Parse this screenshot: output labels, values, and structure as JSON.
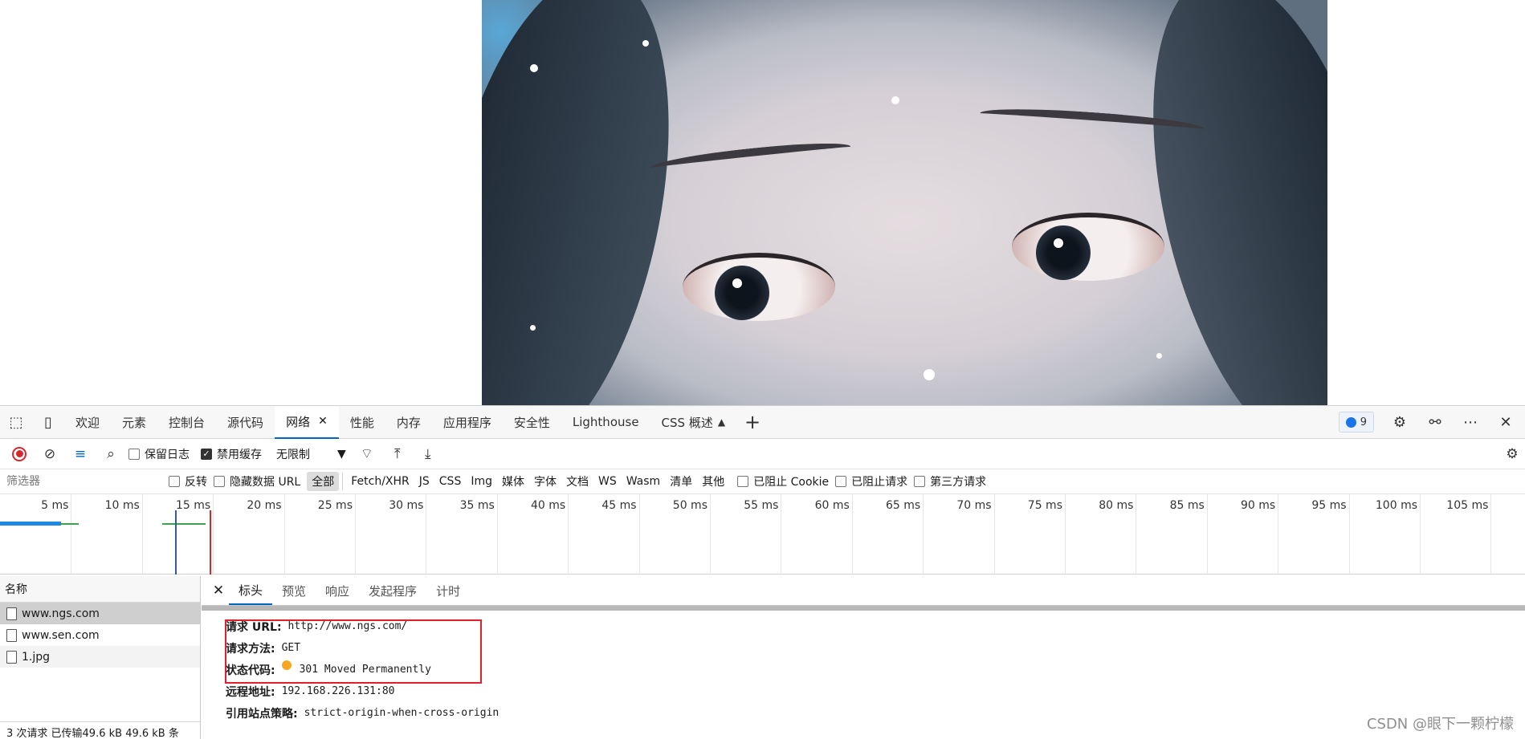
{
  "devtools": {
    "tabs": [
      "欢迎",
      "元素",
      "控制台",
      "源代码",
      "网络",
      "性能",
      "内存",
      "应用程序",
      "安全性",
      "Lighthouse",
      "CSS 概述"
    ],
    "active_tab": "网络",
    "issues_count": "9"
  },
  "toolbar": {
    "preserve_log": "保留日志",
    "disable_cache": "禁用缓存",
    "throttle": "无限制"
  },
  "filter": {
    "placeholder": "筛选器",
    "invert": "反转",
    "hide_data_url": "隐藏数据 URL",
    "types": [
      "全部",
      "Fetch/XHR",
      "JS",
      "CSS",
      "Img",
      "媒体",
      "字体",
      "文档",
      "WS",
      "Wasm",
      "清单",
      "其他"
    ],
    "blocked_cookie": "已阻止 Cookie",
    "blocked_request": "已阻止请求",
    "third_party": "第三方请求"
  },
  "timeline": {
    "ticks": [
      "5 ms",
      "10 ms",
      "15 ms",
      "20 ms",
      "25 ms",
      "30 ms",
      "35 ms",
      "40 ms",
      "45 ms",
      "50 ms",
      "55 ms",
      "60 ms",
      "65 ms",
      "70 ms",
      "75 ms",
      "80 ms",
      "85 ms",
      "90 ms",
      "95 ms",
      "100 ms",
      "105 ms"
    ]
  },
  "requests": {
    "header": "名称",
    "items": [
      "www.ngs.com",
      "www.sen.com",
      "1.jpg"
    ],
    "status": "3 次请求  已传输49.6 kB  49.6 kB 条"
  },
  "detail": {
    "tabs": [
      "标头",
      "预览",
      "响应",
      "发起程序",
      "计时"
    ],
    "request_url_label": "请求 URL:",
    "request_url": "http://www.ngs.com/",
    "method_label": "请求方法:",
    "method": "GET",
    "status_label": "状态代码:",
    "status": "301 Moved Permanently",
    "remote_label": "远程地址:",
    "remote": "192.168.226.131:80",
    "referrer_label": "引用站点策略:",
    "referrer": "strict-origin-when-cross-origin"
  },
  "watermark": "CSDN @眼下一颗柠檬",
  "colors": {
    "accent": "#0067c0",
    "record": "#d8262e",
    "highlight": "#e0202a",
    "status_dot": "#f5a623"
  }
}
